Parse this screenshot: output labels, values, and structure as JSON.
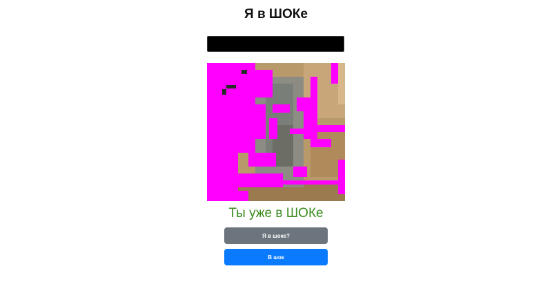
{
  "header": {
    "title": "Я в ШОКе"
  },
  "image": {
    "icon": "glitched-photo"
  },
  "status": {
    "message": "Ты уже в ШОКе",
    "color": "#3a8a1e"
  },
  "buttons": {
    "ask_label": "Я в шоке?",
    "go_label": "В шок"
  },
  "colors": {
    "gray_button": "#6c757d",
    "blue_button": "#0a7bff",
    "glitch_magenta": "#ff00ff"
  }
}
